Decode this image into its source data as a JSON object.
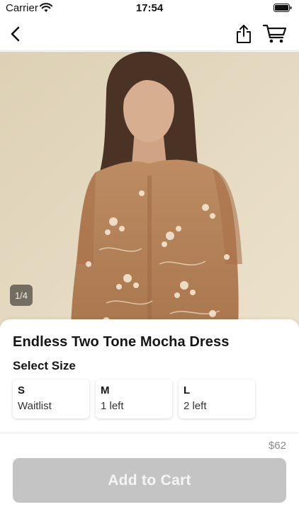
{
  "status_bar": {
    "carrier": "Carrier",
    "time": "17:54"
  },
  "nav": {
    "back_icon": "chevron-left-icon",
    "share_icon": "share-icon",
    "cart_icon": "cart-icon"
  },
  "gallery": {
    "counter": "1/4",
    "current": 1,
    "total": 4
  },
  "product": {
    "title": "Endless Two Tone Mocha Dress",
    "select_size_label": "Select Size",
    "sizes": [
      {
        "name": "S",
        "stock": "Waitlist"
      },
      {
        "name": "M",
        "stock": "1 left"
      },
      {
        "name": "L",
        "stock": "2 left"
      }
    ],
    "price": "$62"
  },
  "cart_button": {
    "label": "Add to Cart",
    "enabled": false
  },
  "colors": {
    "button_disabled": "#c4c4c4",
    "photo_background": "#e6d9be",
    "garment": "#b5825a"
  }
}
